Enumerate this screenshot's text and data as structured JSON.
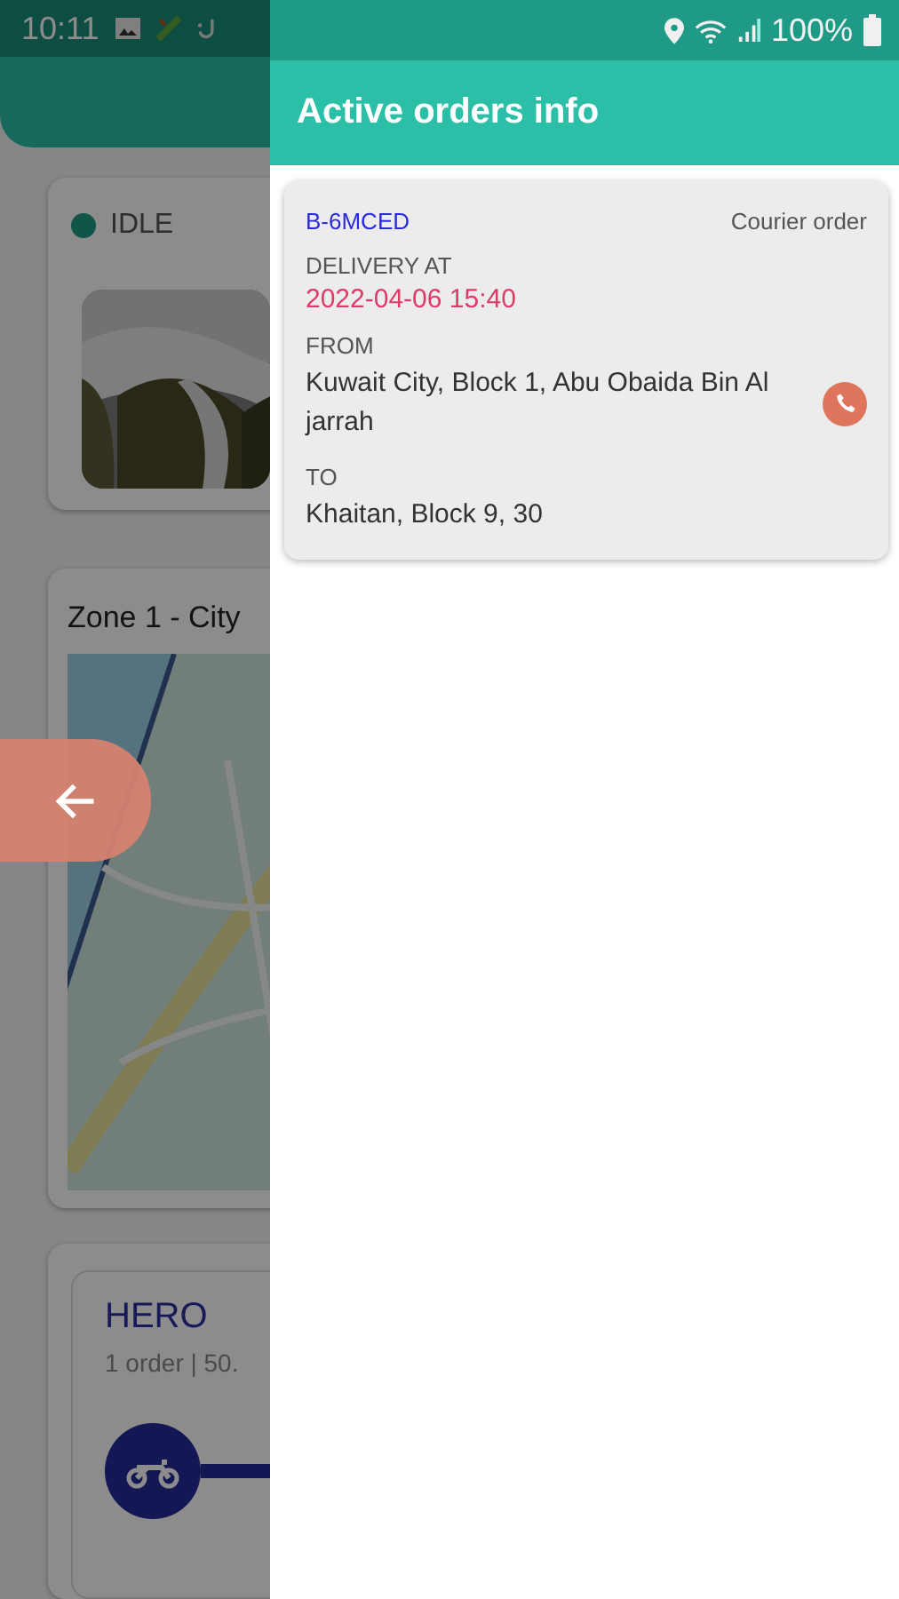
{
  "status_bar": {
    "time": "10:11",
    "battery": "100%"
  },
  "background": {
    "driver_status": "IDLE",
    "zone_title": "Zone 1 - City",
    "courier": {
      "name": "HERO",
      "summary": "1 order | 50."
    }
  },
  "drawer": {
    "title": "Active orders info",
    "orders": [
      {
        "id": "B-6MCED",
        "type": "Courier order",
        "delivery_label": "DELIVERY AT",
        "delivery_time": "2022-04-06 15:40",
        "from_label": "FROM",
        "from": "Kuwait City, Block 1, Abu Obaida Bin Al jarrah",
        "to_label": "TO",
        "to": "Khaitan, Block 9, 30"
      }
    ]
  }
}
